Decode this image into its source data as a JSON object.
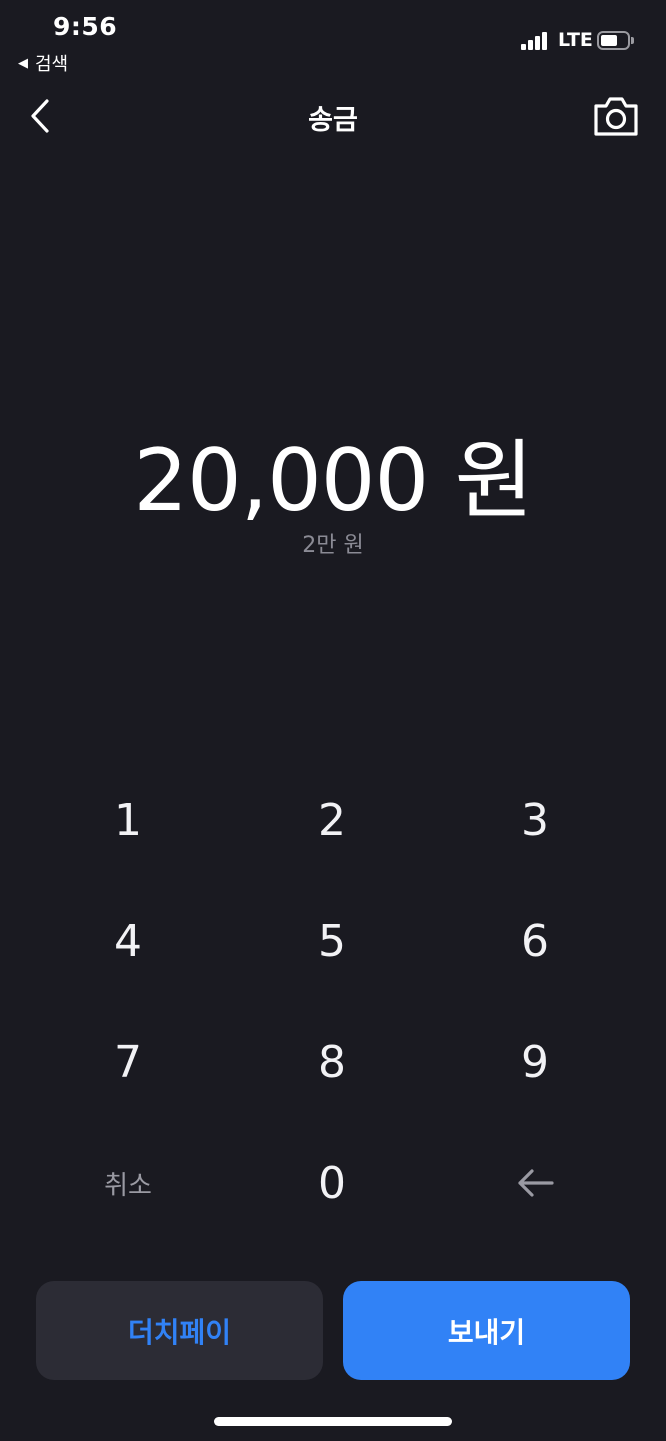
{
  "status_bar": {
    "time": "9:56",
    "back_app_label": "검색",
    "back_arrow_glyph": "◀",
    "network": "LTE",
    "battery_level": 0.65
  },
  "nav": {
    "title": "송금",
    "back_icon": "chevron-left-icon",
    "camera_icon": "camera-icon"
  },
  "amount": {
    "value": "20,000 원",
    "korean_words": "2만 원"
  },
  "keypad": {
    "keys": [
      "1",
      "2",
      "3",
      "4",
      "5",
      "6",
      "7",
      "8",
      "9",
      "취소",
      "0",
      "←"
    ]
  },
  "actions": {
    "dutch_pay_label": "더치페이",
    "send_label": "보내기"
  },
  "colors": {
    "background": "#1a1a21",
    "accent": "#3182f6",
    "secondary_button": "#2c2c35",
    "muted_text": "#8b8b95"
  }
}
